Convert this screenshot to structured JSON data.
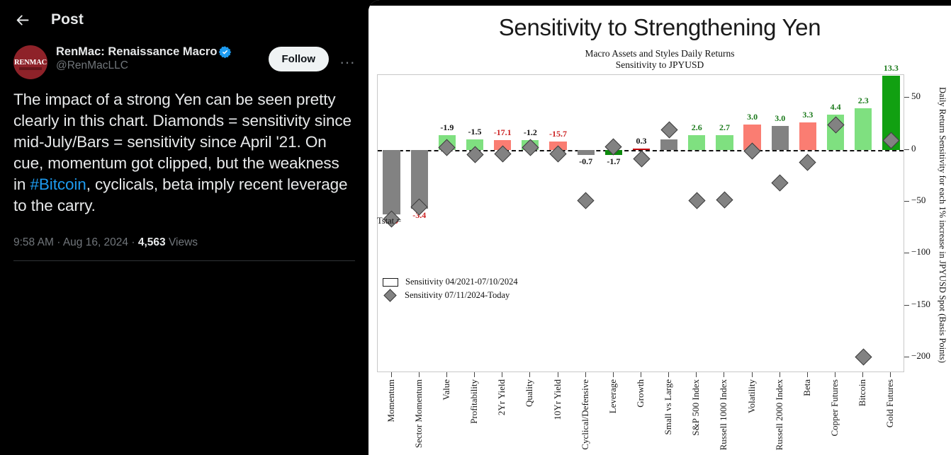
{
  "tweet": {
    "header_title": "Post",
    "back_icon": "back-arrow-icon",
    "display_name": "RenMac: Renaissance Macro",
    "verified_icon": "verified-badge-icon",
    "handle": "@RenMacLLC",
    "avatar_text": "RENMAC",
    "follow_label": "Follow",
    "more_label": "···",
    "body_part1": "The impact of a strong Yen can be seen pretty clearly in this chart.  Diamonds = sensitivity since mid-July/Bars = sensitivity since April '21.  On cue, momentum got clipped, but the weakness in ",
    "hashtag": "#Bitcoin",
    "body_part2": ", cyclicals, beta imply recent leverage to the carry.",
    "time": "9:58 AM",
    "date": "Aug 16, 2024",
    "views_count": "4,563",
    "views_label": "Views",
    "dot": "·"
  },
  "chart_data": {
    "type": "bar",
    "title": "Sensitivity to Strengthening Yen",
    "subtitle_line1": "Macro Assets and Styles Daily Returns",
    "subtitle_line2": "Sensitivity to JPYUSD",
    "xlabel": "",
    "ylabel": "Daily Return Sensitivity for each 1% increase in JPYUSD Spot",
    "ylabel_line2": "(Basis Points)",
    "ylim": [
      -215,
      72
    ],
    "yticks": [
      50,
      0,
      -50,
      -100,
      -150,
      -200
    ],
    "ytick_labels": [
      "50",
      "0",
      "−50",
      "−100",
      "−150",
      "−200"
    ],
    "grid": false,
    "legend_position": "bottom-left",
    "tstat_prefix": "Tstat =",
    "categories": [
      "Momentum",
      "Sector Momentum",
      "Value",
      "Profitability",
      "2Yr Yield",
      "Quality",
      "10Yr Yield",
      "Cyclical/Defensive",
      "Leverage",
      "Growth",
      "Small vs Large",
      "S&P 500 Index",
      "Russell 1000 Index",
      "Volatility",
      "Russell 2000 Index",
      "Beta",
      "Copper Futures",
      "Bitcoin",
      "Gold Futures"
    ],
    "series": [
      {
        "name": "Sensitivity 04/2021-07/10/2024",
        "type": "bar",
        "values": [
          -62,
          -57,
          14,
          10,
          9,
          9,
          8,
          -5,
          -5,
          1,
          10,
          14,
          14,
          24,
          23,
          26,
          34,
          40,
          71
        ],
        "colors": [
          "#828282",
          "#828282",
          "#7FE080",
          "#7FE080",
          "#FA7D72",
          "#7FE080",
          "#FA7D72",
          "#828282",
          "#0C8A0C",
          "#C0000C",
          "#828282",
          "#7FE080",
          "#7FE080",
          "#FA7D72",
          "#828282",
          "#FA7D72",
          "#7FE080",
          "#7FE080",
          "#11A011"
        ],
        "tstats": [
          "-6.9",
          "-3.4",
          "-1.9",
          "-1.5",
          "-17.1",
          "-1.2",
          "-15.7",
          "-0.7",
          "-1.7",
          "0.3",
          "",
          "2.6",
          "2.7",
          "3.0",
          "3.0",
          "3.3",
          "4.4",
          "2.3",
          "13.3"
        ],
        "tstat_colors": [
          "#CC2222",
          "#CC2222",
          "#111111",
          "#111111",
          "#CC2222",
          "#111111",
          "#CC2222",
          "#111111",
          "#111111",
          "#111111",
          "#111111",
          "#1B7A1B",
          "#1B7A1B",
          "#1B7A1B",
          "#1B7A1B",
          "#1B7A1B",
          "#1B7A1B",
          "#1B7A1B",
          "#1B7A1B"
        ]
      },
      {
        "name": "Sensitivity 07/11/2024-Today",
        "type": "diamond",
        "values": [
          -67,
          -55,
          2,
          -5,
          -4,
          2,
          -4,
          -49,
          3,
          -9,
          19,
          -49,
          -48,
          -1,
          -32,
          -12,
          24,
          -200,
          9
        ]
      }
    ],
    "legend": [
      {
        "marker": "bar",
        "label": "Sensitivity 04/2021-07/10/2024"
      },
      {
        "marker": "diamond",
        "label": "Sensitivity 07/11/2024-Today"
      }
    ]
  }
}
